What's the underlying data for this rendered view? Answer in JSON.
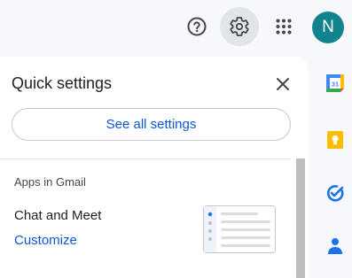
{
  "header": {
    "help_icon": "help-circle-icon",
    "settings_icon": "gear-icon",
    "apps_icon": "apps-grid-icon",
    "avatar_initial": "N",
    "avatar_color": "#11838f"
  },
  "quick_settings": {
    "title": "Quick settings",
    "close_icon": "close-icon",
    "see_all_label": "See all settings",
    "section_heading": "Apps in Gmail",
    "chat_meet_label": "Chat and Meet",
    "customize_label": "Customize"
  },
  "side_apps": {
    "calendar_day": "31",
    "items": [
      "calendar-icon",
      "keep-icon",
      "tasks-icon",
      "contacts-icon"
    ]
  },
  "colors": {
    "accent": "#0b57d0",
    "background": "#f6f8fc",
    "selected_icon_bg": "#e1e5ea"
  }
}
